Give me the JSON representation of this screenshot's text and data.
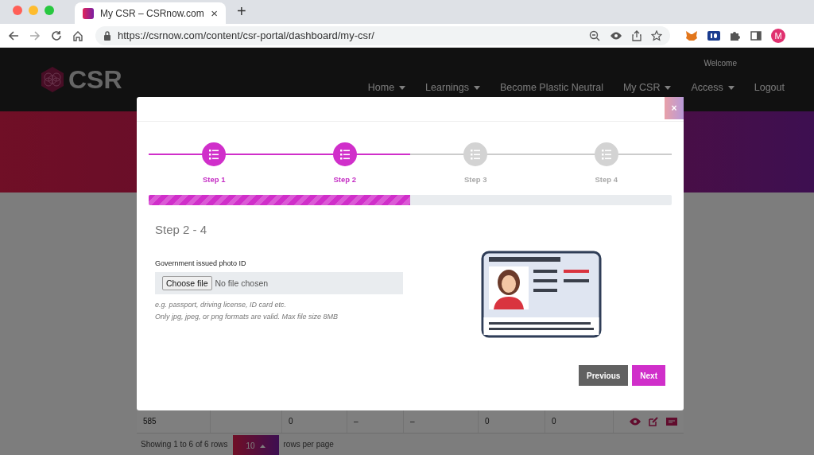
{
  "browser": {
    "tab_title": "My CSR – CSRnow.com",
    "tab_close": "×",
    "new_tab": "+",
    "url": "https://csrnow.com/content/csr-portal/dashboard/my-csr/",
    "profile": "M"
  },
  "site": {
    "logo": "CSR",
    "welcome": "Welcome",
    "nav": [
      {
        "label": "Home",
        "dropdown": true
      },
      {
        "label": "Learnings",
        "dropdown": true
      },
      {
        "label": "Become Plastic Neutral",
        "dropdown": false
      },
      {
        "label": "My CSR",
        "dropdown": true
      },
      {
        "label": "Access",
        "dropdown": true
      },
      {
        "label": "Logout",
        "dropdown": false
      }
    ],
    "table_row": [
      "585",
      "0",
      "–",
      "–",
      "0",
      "0"
    ],
    "footer": {
      "showing": "Showing 1 to 6 of 6 rows",
      "page_size": "10",
      "suffix": "rows per page"
    }
  },
  "modal": {
    "close": "×",
    "steps": [
      {
        "label": "Step 1",
        "done": true
      },
      {
        "label": "Step 2",
        "done": true
      },
      {
        "label": "Step 3",
        "done": false
      },
      {
        "label": "Step 4",
        "done": false
      }
    ],
    "progress": {
      "level": 0.5
    },
    "heading": "Step 2 - 4",
    "field_label": "Government issued photo ID",
    "file_button": "Choose file",
    "file_status": "No file chosen",
    "hints": [
      "e.g. passport, driving license, ID card etc.",
      "Only jpg, jpeg, or png formats are valid. Max file size 8MB"
    ],
    "buttons": [
      {
        "label": "Previous",
        "kind": "secondary"
      },
      {
        "label": "Next",
        "kind": "primary"
      }
    ]
  }
}
